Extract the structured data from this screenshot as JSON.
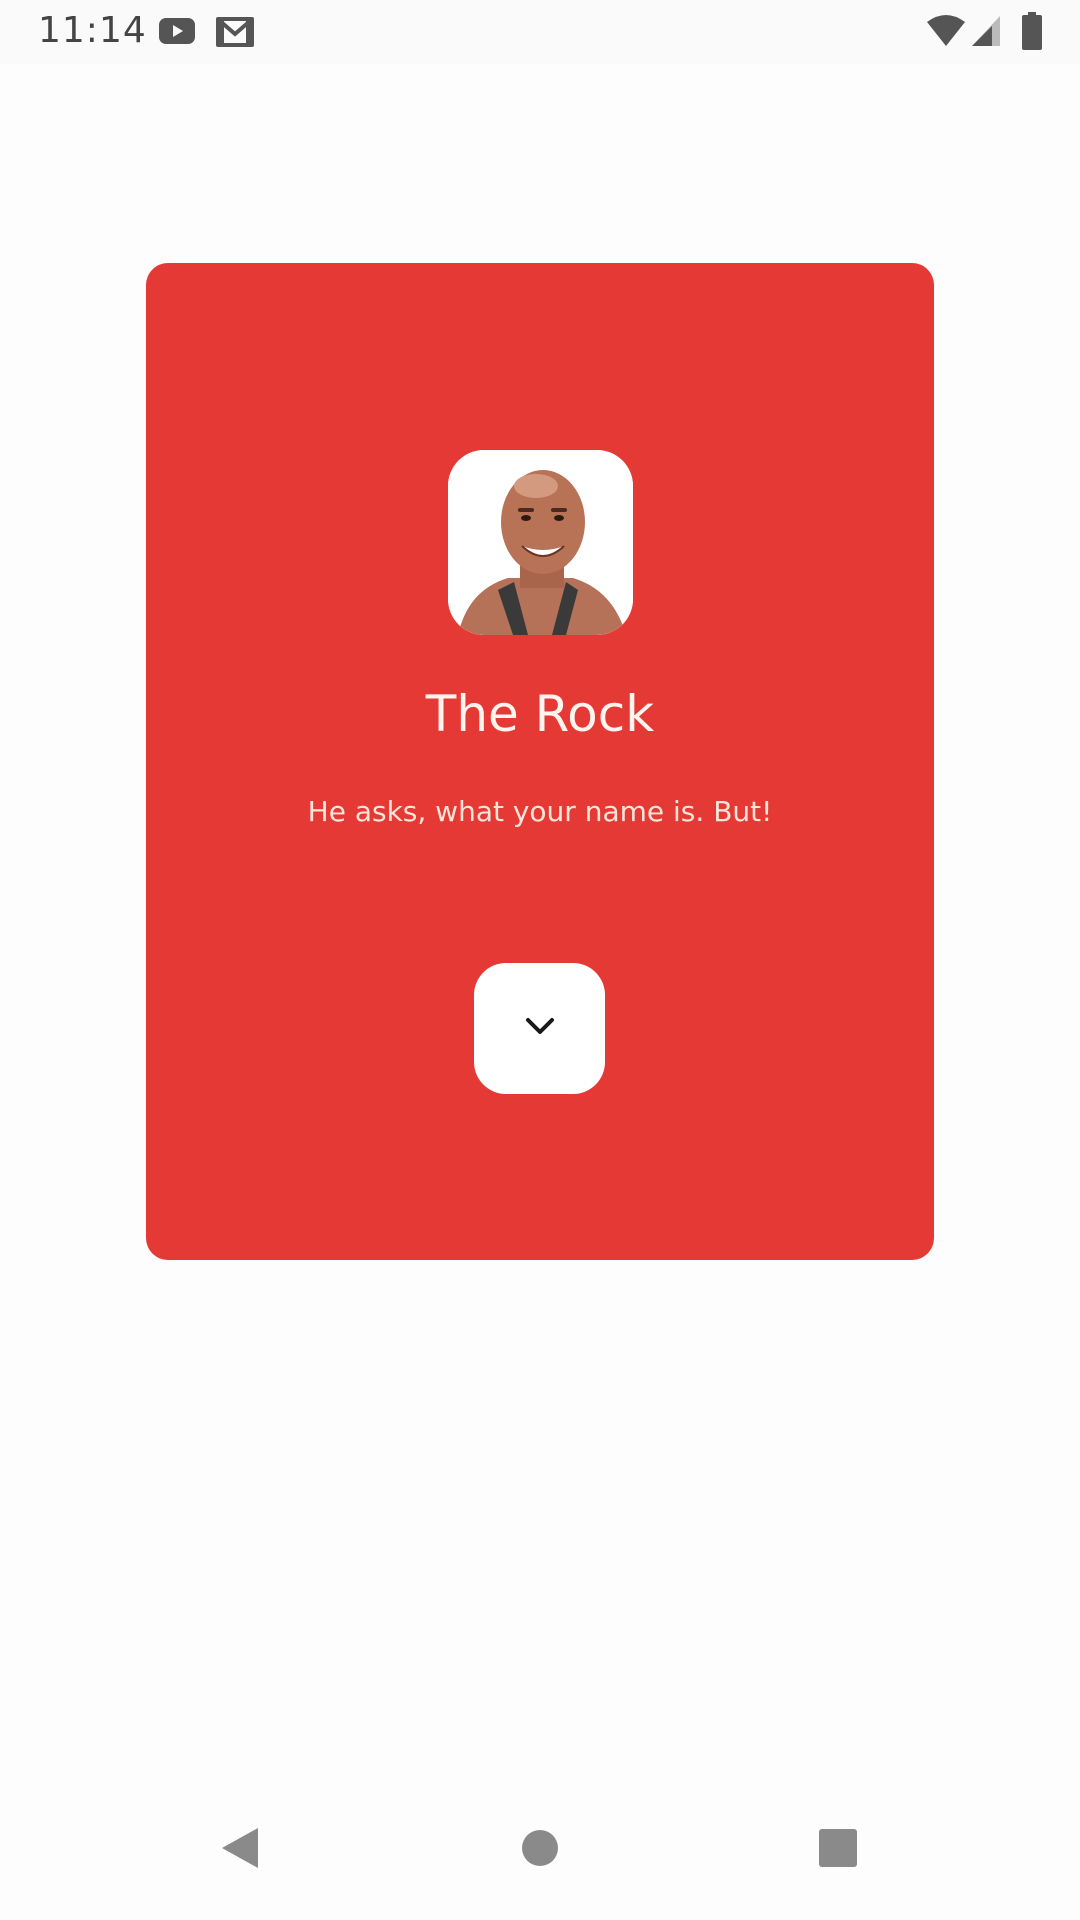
{
  "status_bar": {
    "time": "11:14",
    "icons": [
      "youtube-icon",
      "gmail-icon",
      "wifi-icon",
      "signal-icon",
      "battery-icon"
    ]
  },
  "card": {
    "background_color": "#e53935",
    "avatar_icon": "person-photo",
    "title": "The Rock",
    "subtitle": "He asks, what your name is. But!",
    "expand_button_icon": "chevron-down-icon"
  },
  "nav_bar": {
    "buttons": [
      "back-icon",
      "home-icon",
      "recents-icon"
    ]
  }
}
